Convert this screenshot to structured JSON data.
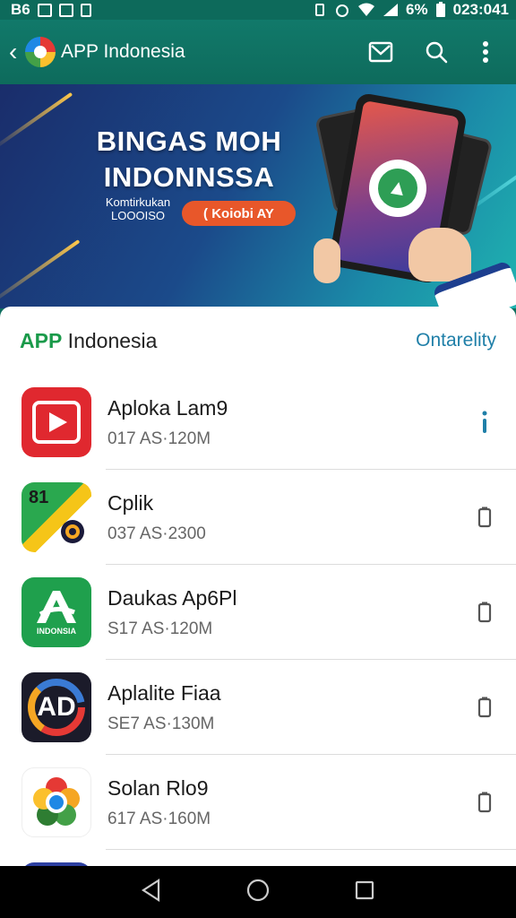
{
  "status": {
    "left": "B6",
    "right_text": "6%",
    "time": "023:041"
  },
  "appbar": {
    "title": "APP Indonesia"
  },
  "banner": {
    "headline_line1": "BINGAS MOH",
    "headline_line2": "INDONNSSA",
    "sub_line1": "Komtirkukan",
    "sub_line2": "LOOOISO",
    "pill": "( Koiobi AY"
  },
  "section": {
    "title_brand": "APP",
    "title_rest": " Indonesia",
    "link": "Ontarelity"
  },
  "apps": [
    {
      "name": "Aploka Lam9",
      "meta": "017 AS·120M",
      "icon": "play-icon",
      "color": "#e0282f"
    },
    {
      "name": "Cplik",
      "meta": "037 AS·2300",
      "icon": "maps-icon",
      "color": "#2aa84f",
      "badge": "81"
    },
    {
      "name": "Daukas Ap6Pl",
      "meta": "S17 AS·120M",
      "icon": "letter-a-icon",
      "color": "#1fa04d",
      "caption": "INDONSIA"
    },
    {
      "name": "Aplalite Fiaa",
      "meta": "SE7 AS·130M",
      "icon": "ad-icon",
      "color": "#1b1b2a",
      "badge": "AD"
    },
    {
      "name": "Solan Rlo9",
      "meta": "617 AS·160M",
      "icon": "chrome-flower-icon",
      "color": "#ffffff"
    }
  ],
  "colors": {
    "primary": "#0f6e5e",
    "accent_green": "#1a9a4a",
    "link_blue": "#1f7fa8",
    "pill_orange": "#e8572a"
  }
}
